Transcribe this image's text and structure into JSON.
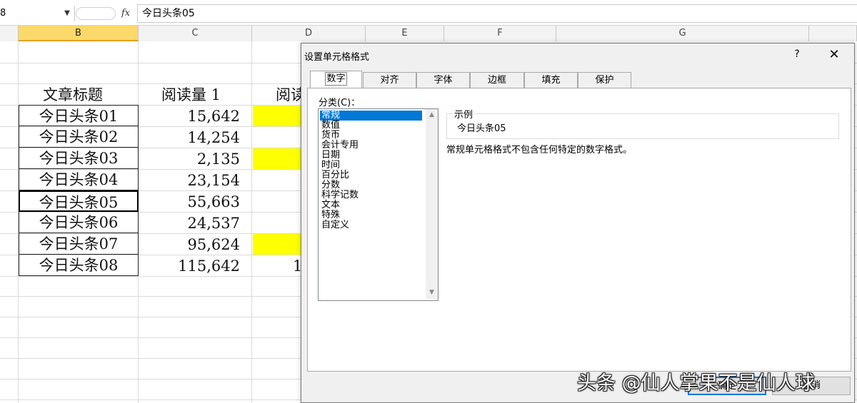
{
  "formula_bar": {
    "name_box": "8",
    "fx_label": "fx",
    "formula": "今日头条05"
  },
  "columns": [
    {
      "letter": "B",
      "selected": true
    },
    {
      "letter": "C",
      "selected": false
    },
    {
      "letter": "D",
      "selected": false
    },
    {
      "letter": "E",
      "selected": false
    },
    {
      "letter": "F",
      "selected": false
    },
    {
      "letter": "G",
      "selected": false
    }
  ],
  "sheet": {
    "header_title": "文章标题",
    "header_reads1": "阅读量 1",
    "header_reads2_partial": "阅读",
    "titles": [
      "今日头条01",
      "今日头条02",
      "今日头条03",
      "今日头条04",
      "今日头条05",
      "今日头条06",
      "今日头条07",
      "今日头条08"
    ],
    "reads": [
      "15,642",
      "14,254",
      "2,135",
      "23,154",
      "55,663",
      "24,537",
      "95,624",
      "115,642"
    ],
    "col_d_row8_partial": "1",
    "highlight_color": "#ffff00"
  },
  "dialog": {
    "title": "设置单元格格式",
    "help_label": "?",
    "close_label": "✕",
    "tabs": [
      "数字",
      "对齐",
      "字体",
      "边框",
      "填充",
      "保护"
    ],
    "active_tab": "数字",
    "category_label": "分类(C)：",
    "categories": [
      "常规",
      "数值",
      "货币",
      "会计专用",
      "日期",
      "时间",
      "百分比",
      "分数",
      "科学记数",
      "文本",
      "特殊",
      "自定义"
    ],
    "selected_category": "常规",
    "sample_legend": "示例",
    "sample_value": "今日头条05",
    "description": "常规单元格格式不包含任何特定的数字格式。",
    "ok_label": "确定",
    "cancel_label": "取消"
  },
  "watermark": "头条 @仙人掌果不是仙人球"
}
